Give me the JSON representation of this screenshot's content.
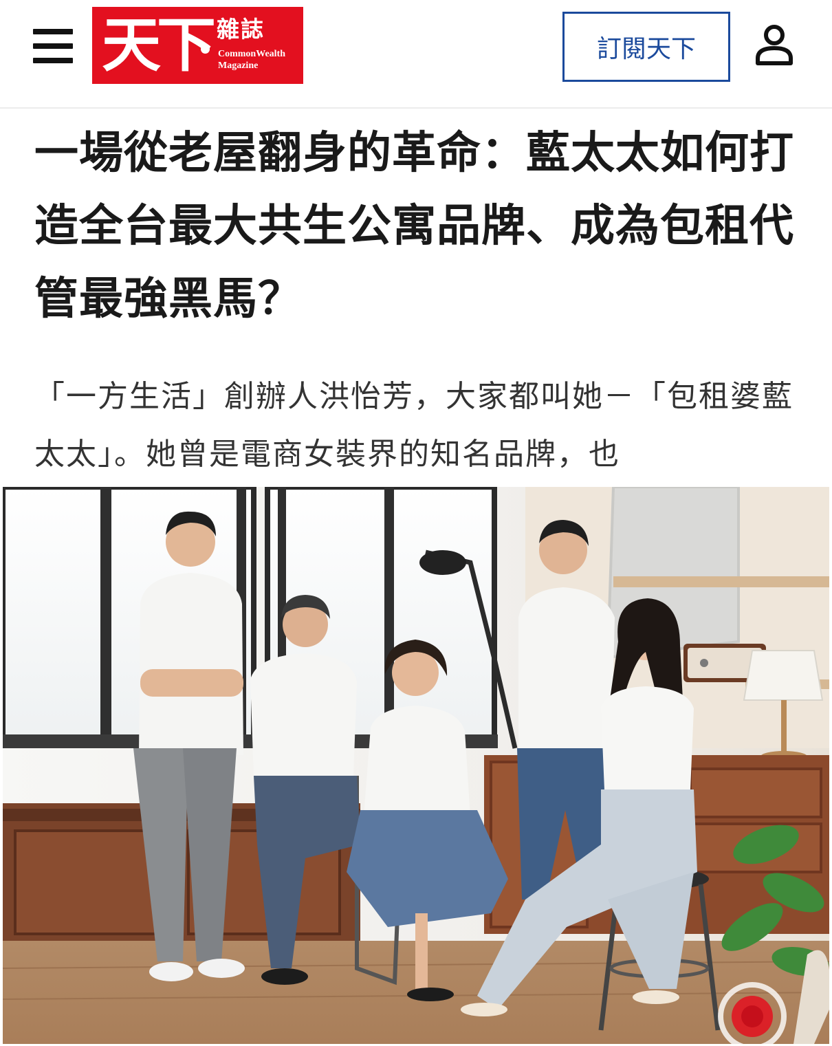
{
  "header": {
    "menu_icon": "hamburger-menu-icon",
    "logo": {
      "mark": "天下",
      "name_zh": "雜誌",
      "name_en_line1": "CommonWealth",
      "name_en_line2": "Magazine"
    },
    "subscribe_label": "訂閱天下",
    "user_icon": "user-account-icon"
  },
  "article": {
    "title": "一場從老屋翻身的革命：藍太太如何打造全台最大共生公寓品牌、成為包租代管最強黑馬？",
    "lead": "「一方生活」創辦人洪怡芳，大家都叫她－「包租婆藍太太」。她曾是電商女裝界的知名品牌，也"
  },
  "colors": {
    "brand_red": "#e3101f",
    "subscribe_blue": "#1b4a9c"
  }
}
